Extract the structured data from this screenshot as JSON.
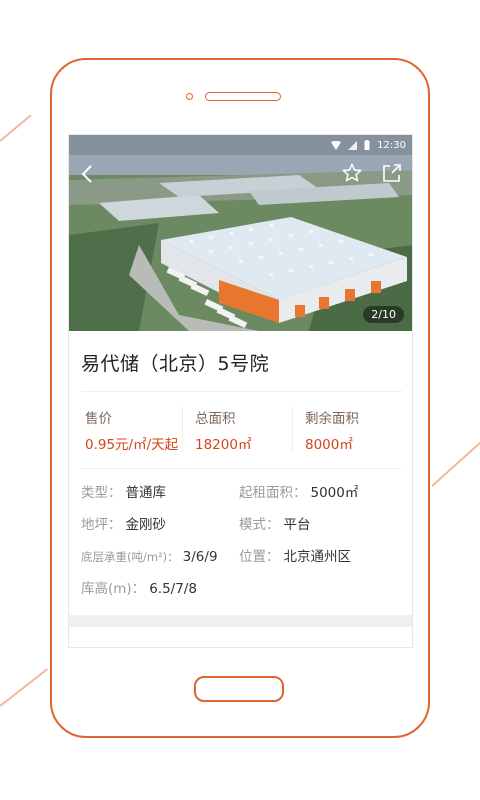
{
  "status_bar": {
    "time": "12:30"
  },
  "hero": {
    "back_icon": "chevron-left-icon",
    "favorite_icon": "star-outline-icon",
    "share_icon": "share-icon",
    "page_indicator": "2/10"
  },
  "listing": {
    "title": "易代储（北京）5号院",
    "stats": [
      {
        "label": "售价",
        "value": "0.95元/㎡/天起"
      },
      {
        "label": "总面积",
        "value": "18200㎡"
      },
      {
        "label": "剩余面积",
        "value": "8000㎡"
      }
    ],
    "attributes": [
      {
        "label": "类型：",
        "value": "普通库"
      },
      {
        "label": "起租面积：",
        "value": "5000㎡"
      },
      {
        "label": "地坪：",
        "value": "金刚砂"
      },
      {
        "label": "模式：",
        "value": "平台"
      },
      {
        "label": "底层承重(吨/m²)：",
        "value": "3/6/9"
      },
      {
        "label": "位置：",
        "value": "北京通州区"
      },
      {
        "label": "库高(m)：",
        "value": "6.5/7/8"
      }
    ]
  },
  "colors": {
    "frame": "#e0652f",
    "price": "#d4461a"
  }
}
